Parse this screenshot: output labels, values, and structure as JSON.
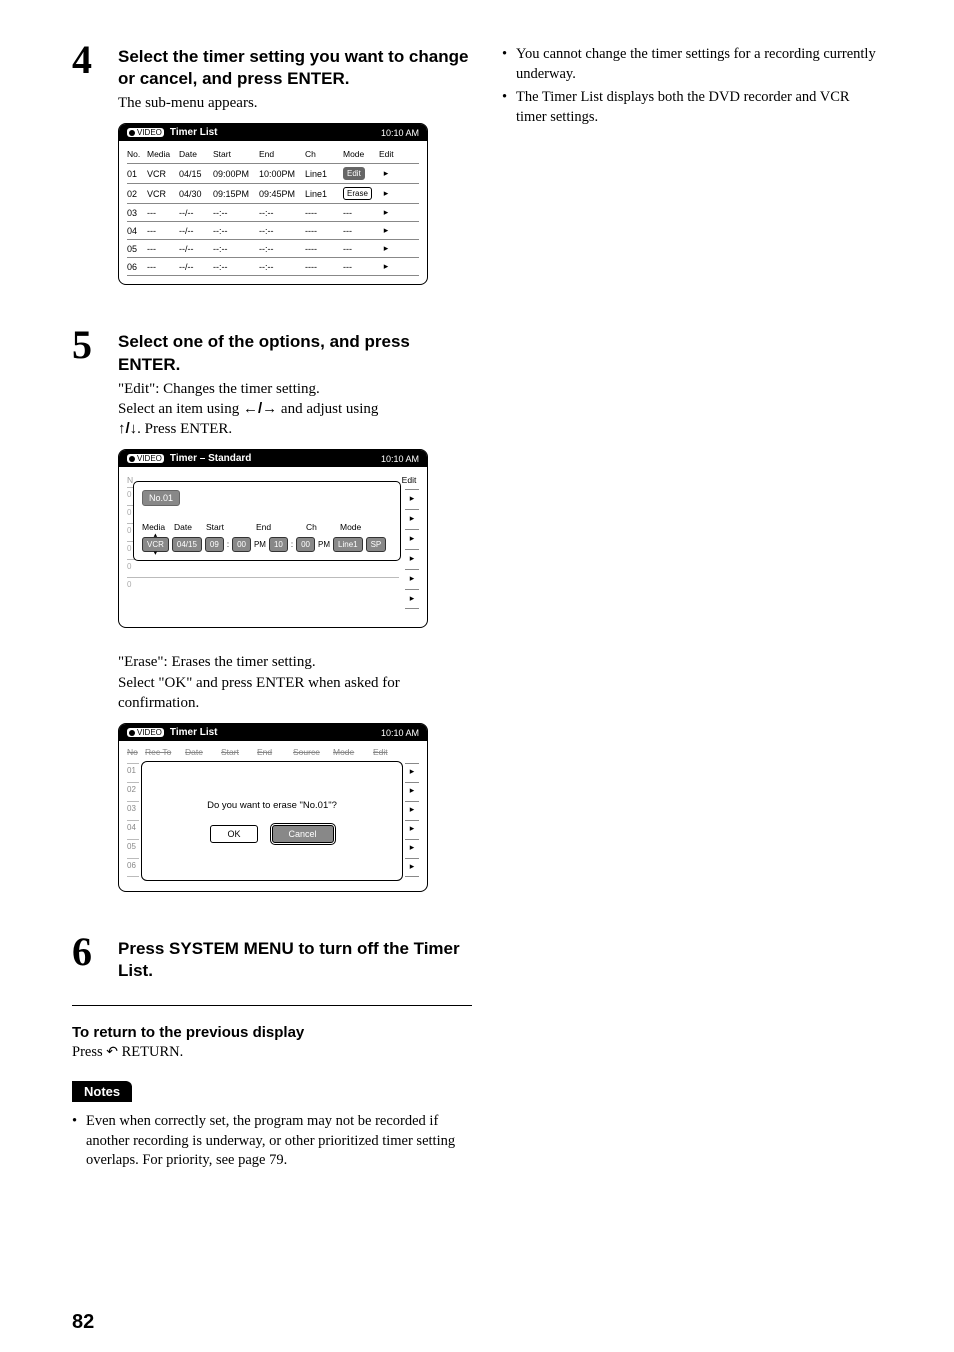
{
  "steps": {
    "s4": {
      "num": "4",
      "title": "Select the timer setting you want to change or cancel, and press ENTER.",
      "text": "The sub-menu appears."
    },
    "s5": {
      "num": "5",
      "title": "Select one of the options, and press ENTER.",
      "edit_label": "\"Edit\": Changes the timer setting.",
      "edit_text1": "Select an item using ",
      "edit_text1b": " and adjust using ",
      "edit_text2": ". Press ENTER.",
      "erase_label": "\"Erase\": Erases the timer setting.",
      "erase_text": "Select \"OK\" and press ENTER when asked for confirmation."
    },
    "s6": {
      "num": "6",
      "title": "Press SYSTEM MENU to turn off the Timer List."
    }
  },
  "panel1": {
    "video_label": "VIDEO",
    "title": "Timer List",
    "time": "10:10 AM",
    "headers": [
      "No.",
      "Media",
      "Date",
      "Start",
      "End",
      "Ch",
      "Mode",
      "Edit"
    ],
    "rows": [
      {
        "no": "01",
        "media": "VCR",
        "date": "04/15",
        "start": "09:00PM",
        "end": "10:00PM",
        "ch": "Line1",
        "mode": "Edit",
        "selected": true
      },
      {
        "no": "02",
        "media": "VCR",
        "date": "04/30",
        "start": "09:15PM",
        "end": "09:45PM",
        "ch": "Line1",
        "mode": "Erase",
        "selected": false
      },
      {
        "no": "03",
        "media": "---",
        "date": "--/--",
        "start": "--:--",
        "end": "--:--",
        "ch": "----",
        "mode": "---",
        "selected": false
      },
      {
        "no": "04",
        "media": "---",
        "date": "--/--",
        "start": "--:--",
        "end": "--:--",
        "ch": "----",
        "mode": "---",
        "selected": false
      },
      {
        "no": "05",
        "media": "---",
        "date": "--/--",
        "start": "--:--",
        "end": "--:--",
        "ch": "----",
        "mode": "---",
        "selected": false
      },
      {
        "no": "06",
        "media": "---",
        "date": "--/--",
        "start": "--:--",
        "end": "--:--",
        "ch": "----",
        "mode": "---",
        "selected": false
      }
    ]
  },
  "panel2": {
    "video_label": "VIDEO",
    "title": "Timer – Standard",
    "time": "10:10 AM",
    "edit_col": "Edit",
    "bg_head": "N",
    "no_label": "No.01",
    "sub_headers": [
      "Media",
      "Date",
      "Start",
      "End",
      "Ch",
      "Mode"
    ],
    "fields": {
      "media": "VCR",
      "date": "04/15",
      "start_h": "09",
      "start_m": "00",
      "start_ampm": "PM",
      "end_h": "10",
      "end_m": "00",
      "end_ampm": "PM",
      "ch": "Line1",
      "mode": "SP",
      "colon": ":"
    }
  },
  "panel3": {
    "video_label": "VIDEO",
    "title": "Timer List",
    "time": "10:10 AM",
    "bg_headers": [
      "No",
      "Rec To",
      "Date",
      "Start",
      "End",
      "Source",
      "Mode",
      "Edit"
    ],
    "side": [
      "01",
      "02",
      "03",
      "04",
      "05",
      "06"
    ],
    "question": "Do you want to erase \"No.01\"?",
    "ok": "OK",
    "cancel": "Cancel"
  },
  "returnSection": {
    "heading": "To return to the previous display",
    "text_a": "Press ",
    "text_b": " RETURN."
  },
  "notes": {
    "label": "Notes",
    "left_bullet": "Even when correctly set, the program may not be recorded if another recording is underway, or other prioritized timer setting overlaps. For priority, see page 79.",
    "right_bullets": [
      "You cannot change the timer settings for a recording currently underway.",
      "The Timer List displays both the DVD recorder and VCR timer settings."
    ]
  },
  "arrows": {
    "leftRight": "←/→",
    "upDown": "↑/↓",
    "tri": "▸",
    "dot": "•",
    "return": "↶"
  },
  "pageNum": "82"
}
